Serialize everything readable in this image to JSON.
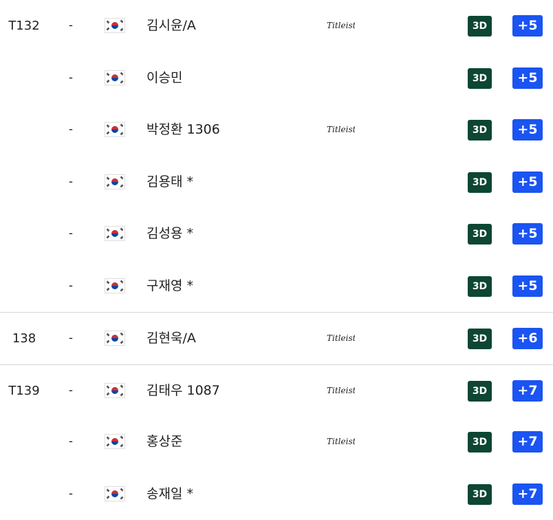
{
  "leaderboard": {
    "rows": [
      {
        "position": "T132",
        "movement": "-",
        "flag": "south-korea-flag",
        "name": "김시윤/A",
        "brand": "Titleist",
        "view3d_label": "3D",
        "score": "+5"
      },
      {
        "position": "",
        "movement": "-",
        "flag": "south-korea-flag",
        "name": "이승민",
        "brand": "",
        "view3d_label": "3D",
        "score": "+5"
      },
      {
        "position": "",
        "movement": "-",
        "flag": "south-korea-flag",
        "name": "박정환 1306",
        "brand": "Titleist",
        "view3d_label": "3D",
        "score": "+5"
      },
      {
        "position": "",
        "movement": "-",
        "flag": "south-korea-flag",
        "name": "김용태 *",
        "brand": "",
        "view3d_label": "3D",
        "score": "+5"
      },
      {
        "position": "",
        "movement": "-",
        "flag": "south-korea-flag",
        "name": "김성용 *",
        "brand": "",
        "view3d_label": "3D",
        "score": "+5"
      },
      {
        "position": "",
        "movement": "-",
        "flag": "south-korea-flag",
        "name": "구재영 *",
        "brand": "",
        "view3d_label": "3D",
        "score": "+5"
      },
      {
        "position": "138",
        "movement": "-",
        "flag": "south-korea-flag",
        "name": "김현욱/A",
        "brand": "Titleist",
        "view3d_label": "3D",
        "score": "+6"
      },
      {
        "position": "T139",
        "movement": "-",
        "flag": "south-korea-flag",
        "name": "김태우 1087",
        "brand": "Titleist",
        "view3d_label": "3D",
        "score": "+7"
      },
      {
        "position": "",
        "movement": "-",
        "flag": "south-korea-flag",
        "name": "홍상준",
        "brand": "Titleist",
        "view3d_label": "3D",
        "score": "+7"
      },
      {
        "position": "",
        "movement": "-",
        "flag": "south-korea-flag",
        "name": "송재일 *",
        "brand": "",
        "view3d_label": "3D",
        "score": "+7"
      }
    ]
  },
  "colors": {
    "view3d_button": "#0d4633",
    "score_badge": "#1a54f2",
    "separator": "#d6d6d6"
  }
}
